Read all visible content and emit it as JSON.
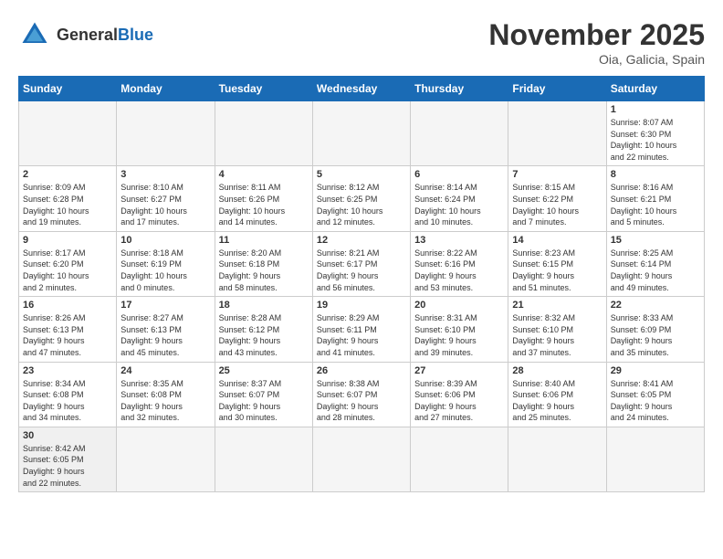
{
  "header": {
    "logo_general": "General",
    "logo_blue": "Blue",
    "month": "November 2025",
    "location": "Oia, Galicia, Spain"
  },
  "weekdays": [
    "Sunday",
    "Monday",
    "Tuesday",
    "Wednesday",
    "Thursday",
    "Friday",
    "Saturday"
  ],
  "weeks": [
    [
      {
        "day": "",
        "info": ""
      },
      {
        "day": "",
        "info": ""
      },
      {
        "day": "",
        "info": ""
      },
      {
        "day": "",
        "info": ""
      },
      {
        "day": "",
        "info": ""
      },
      {
        "day": "",
        "info": ""
      },
      {
        "day": "1",
        "info": "Sunrise: 8:07 AM\nSunset: 6:30 PM\nDaylight: 10 hours\nand 22 minutes."
      }
    ],
    [
      {
        "day": "2",
        "info": "Sunrise: 8:09 AM\nSunset: 6:28 PM\nDaylight: 10 hours\nand 19 minutes."
      },
      {
        "day": "3",
        "info": "Sunrise: 8:10 AM\nSunset: 6:27 PM\nDaylight: 10 hours\nand 17 minutes."
      },
      {
        "day": "4",
        "info": "Sunrise: 8:11 AM\nSunset: 6:26 PM\nDaylight: 10 hours\nand 14 minutes."
      },
      {
        "day": "5",
        "info": "Sunrise: 8:12 AM\nSunset: 6:25 PM\nDaylight: 10 hours\nand 12 minutes."
      },
      {
        "day": "6",
        "info": "Sunrise: 8:14 AM\nSunset: 6:24 PM\nDaylight: 10 hours\nand 10 minutes."
      },
      {
        "day": "7",
        "info": "Sunrise: 8:15 AM\nSunset: 6:22 PM\nDaylight: 10 hours\nand 7 minutes."
      },
      {
        "day": "8",
        "info": "Sunrise: 8:16 AM\nSunset: 6:21 PM\nDaylight: 10 hours\nand 5 minutes."
      }
    ],
    [
      {
        "day": "9",
        "info": "Sunrise: 8:17 AM\nSunset: 6:20 PM\nDaylight: 10 hours\nand 2 minutes."
      },
      {
        "day": "10",
        "info": "Sunrise: 8:18 AM\nSunset: 6:19 PM\nDaylight: 10 hours\nand 0 minutes."
      },
      {
        "day": "11",
        "info": "Sunrise: 8:20 AM\nSunset: 6:18 PM\nDaylight: 9 hours\nand 58 minutes."
      },
      {
        "day": "12",
        "info": "Sunrise: 8:21 AM\nSunset: 6:17 PM\nDaylight: 9 hours\nand 56 minutes."
      },
      {
        "day": "13",
        "info": "Sunrise: 8:22 AM\nSunset: 6:16 PM\nDaylight: 9 hours\nand 53 minutes."
      },
      {
        "day": "14",
        "info": "Sunrise: 8:23 AM\nSunset: 6:15 PM\nDaylight: 9 hours\nand 51 minutes."
      },
      {
        "day": "15",
        "info": "Sunrise: 8:25 AM\nSunset: 6:14 PM\nDaylight: 9 hours\nand 49 minutes."
      }
    ],
    [
      {
        "day": "16",
        "info": "Sunrise: 8:26 AM\nSunset: 6:13 PM\nDaylight: 9 hours\nand 47 minutes."
      },
      {
        "day": "17",
        "info": "Sunrise: 8:27 AM\nSunset: 6:13 PM\nDaylight: 9 hours\nand 45 minutes."
      },
      {
        "day": "18",
        "info": "Sunrise: 8:28 AM\nSunset: 6:12 PM\nDaylight: 9 hours\nand 43 minutes."
      },
      {
        "day": "19",
        "info": "Sunrise: 8:29 AM\nSunset: 6:11 PM\nDaylight: 9 hours\nand 41 minutes."
      },
      {
        "day": "20",
        "info": "Sunrise: 8:31 AM\nSunset: 6:10 PM\nDaylight: 9 hours\nand 39 minutes."
      },
      {
        "day": "21",
        "info": "Sunrise: 8:32 AM\nSunset: 6:10 PM\nDaylight: 9 hours\nand 37 minutes."
      },
      {
        "day": "22",
        "info": "Sunrise: 8:33 AM\nSunset: 6:09 PM\nDaylight: 9 hours\nand 35 minutes."
      }
    ],
    [
      {
        "day": "23",
        "info": "Sunrise: 8:34 AM\nSunset: 6:08 PM\nDaylight: 9 hours\nand 34 minutes."
      },
      {
        "day": "24",
        "info": "Sunrise: 8:35 AM\nSunset: 6:08 PM\nDaylight: 9 hours\nand 32 minutes."
      },
      {
        "day": "25",
        "info": "Sunrise: 8:37 AM\nSunset: 6:07 PM\nDaylight: 9 hours\nand 30 minutes."
      },
      {
        "day": "26",
        "info": "Sunrise: 8:38 AM\nSunset: 6:07 PM\nDaylight: 9 hours\nand 28 minutes."
      },
      {
        "day": "27",
        "info": "Sunrise: 8:39 AM\nSunset: 6:06 PM\nDaylight: 9 hours\nand 27 minutes."
      },
      {
        "day": "28",
        "info": "Sunrise: 8:40 AM\nSunset: 6:06 PM\nDaylight: 9 hours\nand 25 minutes."
      },
      {
        "day": "29",
        "info": "Sunrise: 8:41 AM\nSunset: 6:05 PM\nDaylight: 9 hours\nand 24 minutes."
      }
    ],
    [
      {
        "day": "30",
        "info": "Sunrise: 8:42 AM\nSunset: 6:05 PM\nDaylight: 9 hours\nand 22 minutes."
      },
      {
        "day": "",
        "info": ""
      },
      {
        "day": "",
        "info": ""
      },
      {
        "day": "",
        "info": ""
      },
      {
        "day": "",
        "info": ""
      },
      {
        "day": "",
        "info": ""
      },
      {
        "day": "",
        "info": ""
      }
    ]
  ]
}
